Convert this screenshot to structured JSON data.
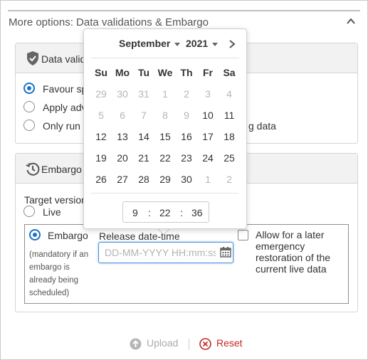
{
  "section": {
    "title": "More options: Data validations & Embargo"
  },
  "validation": {
    "title": "Data valid",
    "options": [
      {
        "label": "Favour sp",
        "selected": true
      },
      {
        "label": "Apply adv",
        "selected": false
      },
      {
        "label": "Only run a",
        "selected": false,
        "suffix": "g data"
      }
    ]
  },
  "embargo": {
    "title": "Embargo",
    "target_version_label": "Target version",
    "live_label": "Live",
    "embargo_label": "Embargo",
    "mandatory_note": [
      "(mandatory if an",
      "embargo is",
      "already being",
      "scheduled)"
    ],
    "release_label": "Release date-time",
    "release_placeholder": "DD-MM-YYYY HH:mm:ss",
    "allow_later_lines": [
      "Allow for a later",
      "emergency",
      "restoration of the",
      "current live data"
    ]
  },
  "actions": {
    "upload": "Upload",
    "reset": "Reset"
  },
  "datepicker": {
    "month": "September",
    "year": "2021",
    "weekdays": [
      "Su",
      "Mo",
      "Tu",
      "We",
      "Th",
      "Fr",
      "Sa"
    ],
    "weeks": [
      [
        {
          "d": "29",
          "m": true
        },
        {
          "d": "30",
          "m": true
        },
        {
          "d": "31",
          "m": true
        },
        {
          "d": "1",
          "m": true
        },
        {
          "d": "2",
          "m": true
        },
        {
          "d": "3",
          "m": true
        },
        {
          "d": "4",
          "m": true
        }
      ],
      [
        {
          "d": "5",
          "m": true
        },
        {
          "d": "6",
          "m": true
        },
        {
          "d": "7",
          "m": true
        },
        {
          "d": "8",
          "m": true
        },
        {
          "d": "9",
          "m": true
        },
        {
          "d": "10",
          "m": false
        },
        {
          "d": "11",
          "m": false
        }
      ],
      [
        {
          "d": "12",
          "m": false
        },
        {
          "d": "13",
          "m": false
        },
        {
          "d": "14",
          "m": false
        },
        {
          "d": "15",
          "m": false
        },
        {
          "d": "16",
          "m": false
        },
        {
          "d": "17",
          "m": false
        },
        {
          "d": "18",
          "m": false
        }
      ],
      [
        {
          "d": "19",
          "m": false
        },
        {
          "d": "20",
          "m": false
        },
        {
          "d": "21",
          "m": false
        },
        {
          "d": "22",
          "m": false
        },
        {
          "d": "23",
          "m": false
        },
        {
          "d": "24",
          "m": false
        },
        {
          "d": "25",
          "m": false
        }
      ],
      [
        {
          "d": "26",
          "m": false
        },
        {
          "d": "27",
          "m": false
        },
        {
          "d": "28",
          "m": false
        },
        {
          "d": "29",
          "m": false
        },
        {
          "d": "30",
          "m": false
        },
        {
          "d": "1",
          "m": true
        },
        {
          "d": "2",
          "m": true
        }
      ]
    ],
    "time": {
      "hour": "9",
      "minute": "22",
      "second": "36",
      "sep": ":"
    }
  },
  "colors": {
    "accent": "#1a73c7",
    "reset": "#c62828",
    "disabled": "#aaaaaa"
  }
}
